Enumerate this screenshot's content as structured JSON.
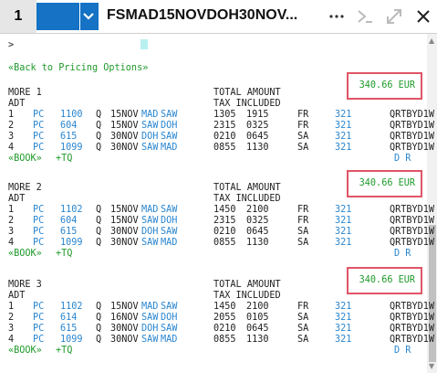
{
  "tab": {
    "number": "1",
    "title": "FSMAD15NOVDOH30NOV..."
  },
  "icons": {
    "more": "more-icon",
    "command": "command-icon",
    "expand": "expand-icon",
    "close": "close-icon"
  },
  "terminal": {
    "prompt": ">",
    "back_link": "«Back to Pricing Options»",
    "options": [
      {
        "header": "MORE 1",
        "total_label": "TOTAL AMOUNT",
        "amount": "340.66 EUR",
        "pax": "ADT",
        "tax_label": "TAX INCLUDED",
        "segments": [
          {
            "n": "1",
            "carrier": "PC",
            "flight": "1100",
            "cls": "Q",
            "date": "15NOV",
            "from": "MAD",
            "to": "SAW",
            "dep": "1305",
            "arr": "1915",
            "day": "FR",
            "eq": "321",
            "fare": "QRTBYD1W"
          },
          {
            "n": "2",
            "carrier": "PC",
            "flight": "604",
            "cls": "Q",
            "date": "15NOV",
            "from": "SAW",
            "to": "DOH",
            "dep": "2315",
            "arr": "0325",
            "day": "FR",
            "eq": "321",
            "fare": "QRTBYD1W"
          },
          {
            "n": "3",
            "carrier": "PC",
            "flight": "615",
            "cls": "Q",
            "date": "30NOV",
            "from": "DOH",
            "to": "SAW",
            "dep": "0210",
            "arr": "0645",
            "day": "SA",
            "eq": "321",
            "fare": "QRTBYD1W"
          },
          {
            "n": "4",
            "carrier": "PC",
            "flight": "1099",
            "cls": "Q",
            "date": "30NOV",
            "from": "SAW",
            "to": "MAD",
            "dep": "0855",
            "arr": "1130",
            "day": "SA",
            "eq": "321",
            "fare": "QRTBYD1W"
          }
        ],
        "book": "«BOOK»",
        "tq": "+TQ",
        "dr": "D R"
      },
      {
        "header": "MORE 2",
        "total_label": "TOTAL AMOUNT",
        "amount": "340.66 EUR",
        "pax": "ADT",
        "tax_label": "TAX INCLUDED",
        "segments": [
          {
            "n": "1",
            "carrier": "PC",
            "flight": "1102",
            "cls": "Q",
            "date": "15NOV",
            "from": "MAD",
            "to": "SAW",
            "dep": "1450",
            "arr": "2100",
            "day": "FR",
            "eq": "321",
            "fare": "QRTBYD1W"
          },
          {
            "n": "2",
            "carrier": "PC",
            "flight": "604",
            "cls": "Q",
            "date": "15NOV",
            "from": "SAW",
            "to": "DOH",
            "dep": "2315",
            "arr": "0325",
            "day": "FR",
            "eq": "321",
            "fare": "QRTBYD1W"
          },
          {
            "n": "3",
            "carrier": "PC",
            "flight": "615",
            "cls": "Q",
            "date": "30NOV",
            "from": "DOH",
            "to": "SAW",
            "dep": "0210",
            "arr": "0645",
            "day": "SA",
            "eq": "321",
            "fare": "QRTBYD1W"
          },
          {
            "n": "4",
            "carrier": "PC",
            "flight": "1099",
            "cls": "Q",
            "date": "30NOV",
            "from": "SAW",
            "to": "MAD",
            "dep": "0855",
            "arr": "1130",
            "day": "SA",
            "eq": "321",
            "fare": "QRTBYD1W"
          }
        ],
        "book": "«BOOK»",
        "tq": "+TQ",
        "dr": "D R"
      },
      {
        "header": "MORE 3",
        "total_label": "TOTAL AMOUNT",
        "amount": "340.66 EUR",
        "pax": "ADT",
        "tax_label": "TAX INCLUDED",
        "segments": [
          {
            "n": "1",
            "carrier": "PC",
            "flight": "1102",
            "cls": "Q",
            "date": "15NOV",
            "from": "MAD",
            "to": "SAW",
            "dep": "1450",
            "arr": "2100",
            "day": "FR",
            "eq": "321",
            "fare": "QRTBYD1W"
          },
          {
            "n": "2",
            "carrier": "PC",
            "flight": "614",
            "cls": "Q",
            "date": "16NOV",
            "from": "SAW",
            "to": "DOH",
            "dep": "2055",
            "arr": "0105",
            "day": "SA",
            "eq": "321",
            "fare": "QRTBYD1W"
          },
          {
            "n": "3",
            "carrier": "PC",
            "flight": "615",
            "cls": "Q",
            "date": "30NOV",
            "from": "DOH",
            "to": "SAW",
            "dep": "0210",
            "arr": "0645",
            "day": "SA",
            "eq": "321",
            "fare": "QRTBYD1W"
          },
          {
            "n": "4",
            "carrier": "PC",
            "flight": "1099",
            "cls": "Q",
            "date": "30NOV",
            "from": "SAW",
            "to": "MAD",
            "dep": "0855",
            "arr": "1130",
            "day": "SA",
            "eq": "321",
            "fare": "QRTBYD1W"
          }
        ],
        "book": "«BOOK»",
        "tq": "+TQ",
        "dr": "D R"
      }
    ]
  },
  "colors": {
    "accent": "#1572c4",
    "link_blue": "#2a86d0",
    "green": "#1e9a2a",
    "highlight": "#e05566"
  }
}
